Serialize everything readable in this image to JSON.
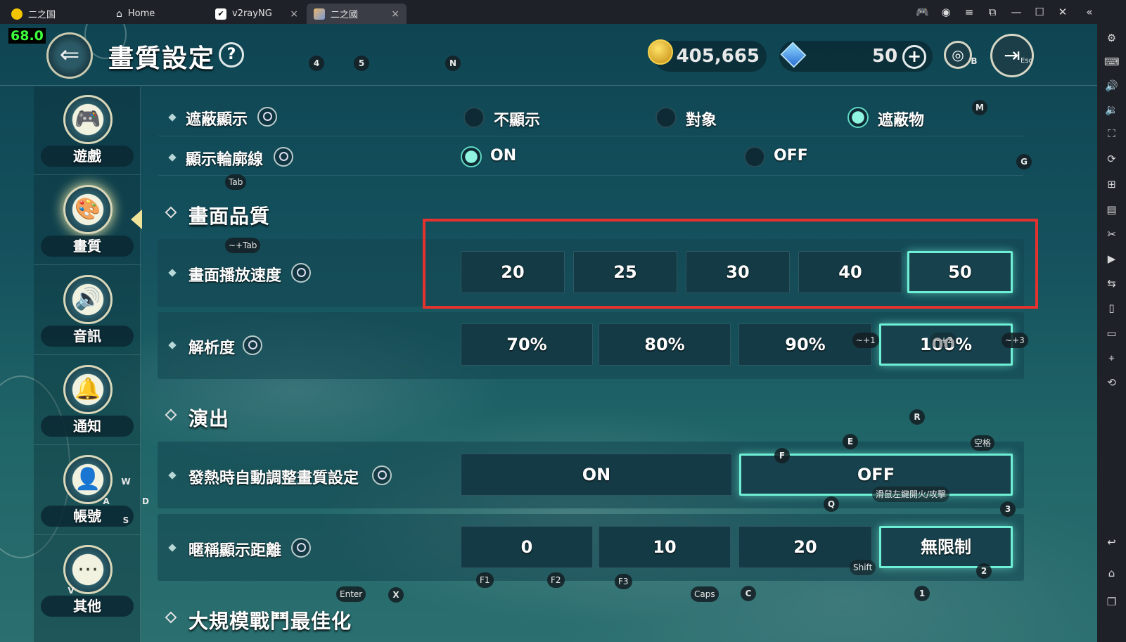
{
  "window": {
    "tabs": [
      {
        "label": "二之国",
        "icon": "ld-logo-icon"
      },
      {
        "label": "Home",
        "icon": "home-icon"
      },
      {
        "label": "v2rayNG",
        "icon": "v2ray-icon"
      },
      {
        "label": "二之國",
        "icon": "game-icon"
      }
    ],
    "fps": "68.0"
  },
  "header": {
    "title": "畫質設定",
    "help": "?",
    "gold": "405,665",
    "gems": "50",
    "plus": "+"
  },
  "sidebar": {
    "items": [
      {
        "label": "遊戲",
        "icon": "gamepad-icon"
      },
      {
        "label": "畫質",
        "icon": "palette-icon"
      },
      {
        "label": "音訊",
        "icon": "speaker-icon"
      },
      {
        "label": "通知",
        "icon": "bell-icon"
      },
      {
        "label": "帳號",
        "icon": "user-icon"
      },
      {
        "label": "其他",
        "icon": "more-icon"
      }
    ],
    "active_index": 1
  },
  "settings": {
    "occlusion": {
      "label": "遮蔽顯示",
      "options": [
        "不顯示",
        "對象",
        "遮蔽物"
      ],
      "selected": "遮蔽物"
    },
    "outline": {
      "label": "顯示輪廓線",
      "options": [
        "ON",
        "OFF"
      ],
      "selected": "ON"
    },
    "quality_section": "畫面品質",
    "framerate": {
      "label": "畫面播放速度",
      "options": [
        "20",
        "25",
        "30",
        "40",
        "50"
      ],
      "selected": "50"
    },
    "resolution": {
      "label": "解析度",
      "options": [
        "70%",
        "80%",
        "90%",
        "100%"
      ],
      "selected": "100%"
    },
    "performance_section": "演出",
    "heat": {
      "label": "發熱時自動調整畫質設定",
      "options": [
        "ON",
        "OFF"
      ],
      "selected": "OFF"
    },
    "nickname": {
      "label": "暱稱顯示距離",
      "options": [
        "0",
        "10",
        "20",
        "無限制"
      ],
      "selected": "無限制"
    },
    "battle_section": "大規模戰鬥最佳化"
  },
  "key_hints": {
    "k4": "4",
    "k5": "5",
    "kN": "N",
    "kB": "B",
    "kEsc": "Esc",
    "kM": "M",
    "kG": "G",
    "kTab": "Tab",
    "kTildeTab": "~+Tab",
    "kT1": "~+1",
    "kT2": "~+2",
    "kT3": "~+3",
    "kR": "R",
    "kE": "E",
    "kSpace": "空格",
    "kF": "F",
    "kQ": "Q",
    "k3": "3",
    "kMouse": "滑鼠左鍵開火/攻擊",
    "kW": "W",
    "kA": "A",
    "kS": "S",
    "kD": "D",
    "kShift": "Shift",
    "k2": "2",
    "k1": "1",
    "kF1": "F1",
    "kF2": "F2",
    "kF3": "F3",
    "kEnter": "Enter",
    "kX": "X",
    "kCaps": "Caps",
    "kC": "C",
    "kV": "V"
  },
  "colors": {
    "selected_border": "#6ff0d6",
    "highlight_box": "#e4322f",
    "fps_text": "#3cff3c"
  }
}
